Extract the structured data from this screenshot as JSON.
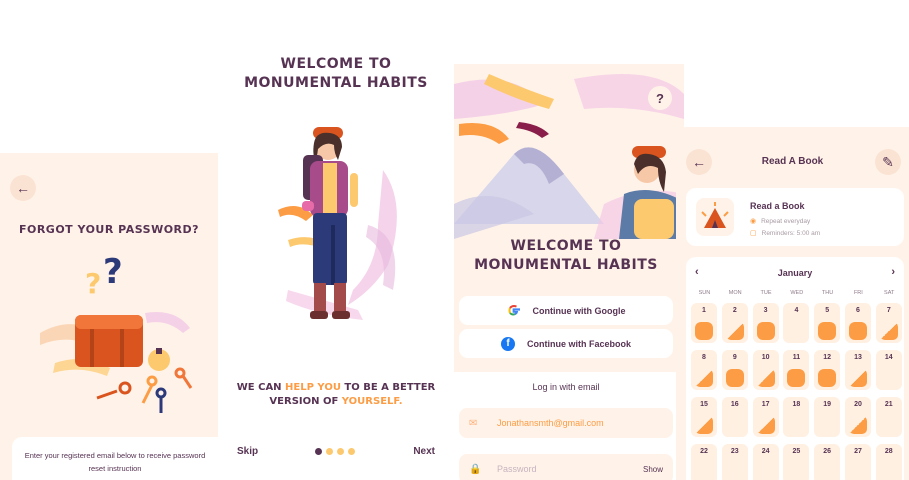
{
  "colors": {
    "primary": "#573353",
    "accent": "#fc9d45",
    "accent_light": "#fdc96e",
    "background": "#fff3e9",
    "card": "#ffffff"
  },
  "forgot_password": {
    "back_icon": "arrow-left-icon",
    "title": "FORGOT YOUR PASSWORD?",
    "info_text": "Enter your registered email below to receive password reset instruction"
  },
  "welcome": {
    "title_line1": "WELCOME TO",
    "title_line2": "MONUMENTAL HABITS",
    "tagline_part1": "WE CAN ",
    "tagline_highlight1": "HELP YOU",
    "tagline_part2": " TO BE A BETTER VERSION OF ",
    "tagline_highlight2": "YOURSELF.",
    "skip_label": "Skip",
    "next_label": "Next",
    "page_indicator": {
      "total": 4,
      "active": 1
    }
  },
  "login": {
    "help_icon_label": "?",
    "title_line1": "WELCOME TO",
    "title_line2": "MONUMENTAL HABITS",
    "google_label": "Continue with Google",
    "facebook_label": "Continue with Facebook",
    "email_section_label": "Log in with email",
    "email_value": "Jonathansmth@gmail.com",
    "password_placeholder": "Password",
    "show_label": "Show"
  },
  "habit": {
    "header_title": "Read A Book",
    "habit_name": "Read a Book",
    "repeat_text": "Repeat everyday",
    "reminder_text": "Reminders: 5:00 am",
    "month": "January",
    "weekdays": [
      "SUN",
      "MON",
      "TUE",
      "WED",
      "THU",
      "FRI",
      "SAT"
    ],
    "days": [
      {
        "d": "1",
        "s": "full"
      },
      {
        "d": "2",
        "s": "half"
      },
      {
        "d": "3",
        "s": "full"
      },
      {
        "d": "4",
        "s": "none"
      },
      {
        "d": "5",
        "s": "full"
      },
      {
        "d": "6",
        "s": "full"
      },
      {
        "d": "7",
        "s": "half"
      },
      {
        "d": "8",
        "s": "half"
      },
      {
        "d": "9",
        "s": "full"
      },
      {
        "d": "10",
        "s": "half"
      },
      {
        "d": "11",
        "s": "full"
      },
      {
        "d": "12",
        "s": "full"
      },
      {
        "d": "13",
        "s": "half"
      },
      {
        "d": "14",
        "s": "none"
      },
      {
        "d": "15",
        "s": "half"
      },
      {
        "d": "16",
        "s": "none"
      },
      {
        "d": "17",
        "s": "half"
      },
      {
        "d": "18",
        "s": "none"
      },
      {
        "d": "19",
        "s": "none"
      },
      {
        "d": "20",
        "s": "half"
      },
      {
        "d": "21",
        "s": "none"
      },
      {
        "d": "22",
        "s": "none"
      },
      {
        "d": "23",
        "s": "none"
      },
      {
        "d": "24",
        "s": "none"
      },
      {
        "d": "25",
        "s": "none"
      },
      {
        "d": "26",
        "s": "none"
      },
      {
        "d": "27",
        "s": "none"
      },
      {
        "d": "28",
        "s": "none"
      }
    ]
  }
}
